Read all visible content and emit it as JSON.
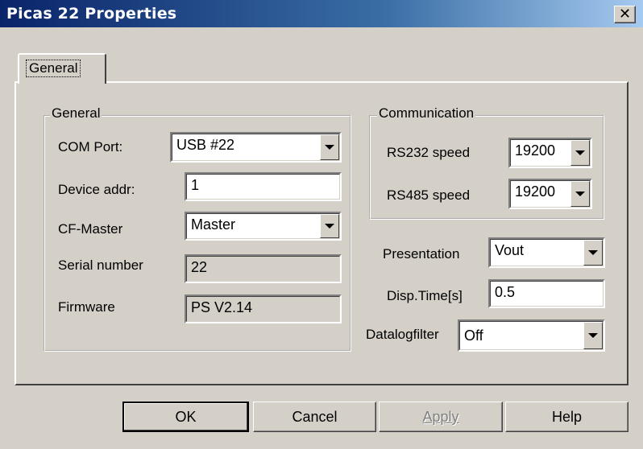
{
  "window": {
    "title": "Picas 22 Properties",
    "close_glyph": "✕"
  },
  "tabs": [
    {
      "label": "General",
      "active": true
    }
  ],
  "general_group": {
    "title": "General",
    "com_port": {
      "label": "COM Port:",
      "value": "USB #22"
    },
    "device_addr": {
      "label": "Device addr:",
      "value": "1"
    },
    "cf_master": {
      "label": "CF-Master",
      "value": "Master"
    },
    "serial_number": {
      "label": "Serial number",
      "value": "22"
    },
    "firmware": {
      "label": "Firmware",
      "value": "PS V2.14"
    }
  },
  "communication_group": {
    "title": "Communication",
    "rs232": {
      "label": "RS232 speed",
      "value": "19200"
    },
    "rs485": {
      "label": "RS485 speed",
      "value": "19200"
    }
  },
  "presentation": {
    "label": "Presentation",
    "value": "Vout"
  },
  "disp_time": {
    "label": "Disp.Time[s]",
    "value": "0.5"
  },
  "datalogfilter": {
    "label": "Datalogfilter",
    "value": "Off"
  },
  "buttons": {
    "ok": "OK",
    "cancel": "Cancel",
    "apply": "Apply",
    "help": "Help"
  },
  "colors": {
    "face": "#d4d0c8",
    "title_start": "#0a246a",
    "title_end": "#a6caf0"
  }
}
